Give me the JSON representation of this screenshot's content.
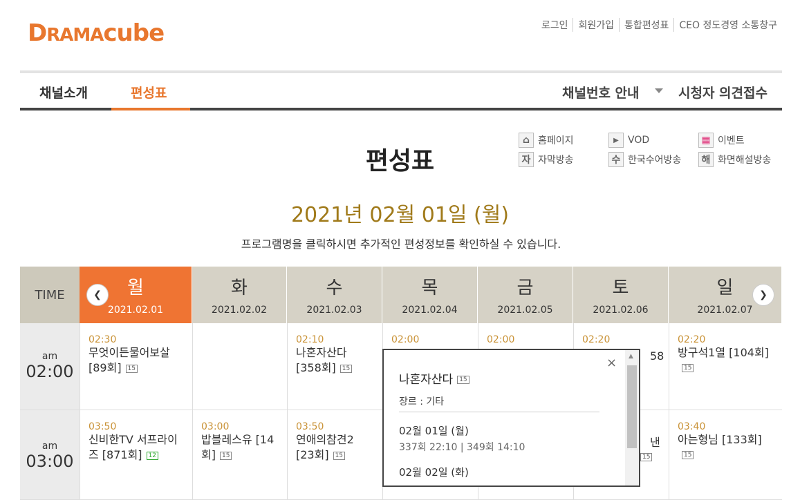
{
  "logo": {
    "d": "D",
    "rama": "RAMA",
    "cube": "cube"
  },
  "util_links": [
    "로그인",
    "회원가입",
    "통합편성표",
    "CEO 정도경영 소통창구"
  ],
  "gnb": {
    "channel_intro": "채널소개",
    "schedule": "편성표",
    "channel_number": "채널번호 안내",
    "viewer_opinion": "시청자 의견접수"
  },
  "page_title": "편성표",
  "legend": [
    {
      "icon": "home-icon",
      "glyph": "⌂",
      "label": "홈페이지"
    },
    {
      "icon": "play-icon",
      "glyph": "▶",
      "label": "VOD"
    },
    {
      "icon": "event-icon",
      "glyph": "▦",
      "label": "이벤트"
    },
    {
      "icon": "subtitle-icon",
      "glyph": "자",
      "label": "자막방송"
    },
    {
      "icon": "sign-language-icon",
      "glyph": "수",
      "label": "한국수어방송"
    },
    {
      "icon": "audio-description-icon",
      "glyph": "해",
      "label": "화면해설방송"
    }
  ],
  "date_heading": "2021년 02월 01일 (월)",
  "notice": "프로그램명을 클릭하시면 추가적인 편성정보를 확인하실 수 있습니다.",
  "table": {
    "time_label": "TIME",
    "days": [
      {
        "day": "월",
        "date": "2021.02.01"
      },
      {
        "day": "화",
        "date": "2021.02.02"
      },
      {
        "day": "수",
        "date": "2021.02.03"
      },
      {
        "day": "목",
        "date": "2021.02.04"
      },
      {
        "day": "금",
        "date": "2021.02.05"
      },
      {
        "day": "토",
        "date": "2021.02.06"
      },
      {
        "day": "일",
        "date": "2021.02.07"
      }
    ],
    "rows": [
      {
        "ampm": "am",
        "hour": "02:00",
        "cells": [
          {
            "time": "02:30",
            "name": "무엇이든물어보살 [89회]",
            "rating": "15"
          },
          {
            "time": "",
            "name": "",
            "rating": ""
          },
          {
            "time": "02:10",
            "name": "나혼자산다 [358회]",
            "rating": "15"
          },
          {
            "time": "02:00",
            "name": "",
            "rating": ""
          },
          {
            "time": "02:00",
            "name": "",
            "rating": ""
          },
          {
            "time": "02:20",
            "name": "58",
            "rating": ""
          },
          {
            "time": "02:20",
            "name": "방구석1열 [104회]",
            "rating": "15"
          }
        ]
      },
      {
        "ampm": "am",
        "hour": "03:00",
        "cells": [
          {
            "time": "03:50",
            "name": "신비한TV 서프라이즈 [871회]",
            "rating": "12"
          },
          {
            "time": "03:00",
            "name": "밥블레스유 [14회]",
            "rating": "15"
          },
          {
            "time": "03:50",
            "name": "연애의참견2 [23회]",
            "rating": "15"
          },
          {
            "time": "",
            "name": "",
            "rating": ""
          },
          {
            "time": "",
            "name": "",
            "rating": ""
          },
          {
            "time": "",
            "name": "낸",
            "rating": "15"
          },
          {
            "time": "03:40",
            "name": "아는형님 [133회]",
            "rating": "15"
          }
        ]
      }
    ]
  },
  "popup": {
    "title": "나혼자산다",
    "rating": "15",
    "genre": "장르 : 기타",
    "date1": "02월 01일 (월)",
    "episodes1": "337회 22:10  |  349회 14:10",
    "date2": "02월 02일 (화)",
    "close": "×"
  }
}
